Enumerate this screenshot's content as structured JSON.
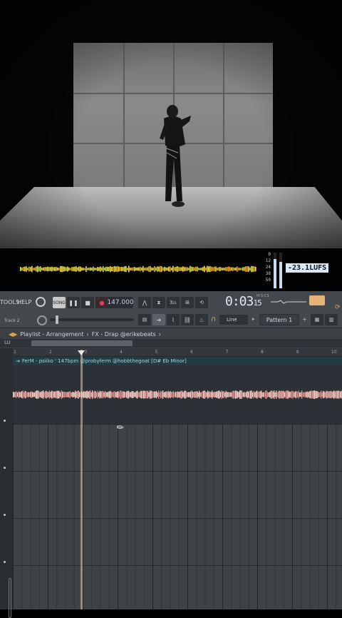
{
  "meter": {
    "db_scale": [
      "0",
      "12",
      "24",
      "38",
      "50"
    ],
    "lufs": "-23.1LUFS",
    "level_left": 0.82,
    "level_right": 0.74
  },
  "daw": {
    "menu": {
      "tools": "TOOLS",
      "help": "HELP"
    },
    "transport": {
      "song_label": "SONG",
      "tempo": "147.000"
    },
    "time": {
      "main": "0:03",
      "sub": "15",
      "units": "M:S:CS"
    },
    "snap": "Line",
    "pattern": "Pattern 1",
    "track_label": "Track 2",
    "breadcrumb": {
      "section": "Playlist - Arrangement",
      "sep": "›",
      "item": "FX - Drap @erikebeats",
      "end": "›"
    },
    "ruler": {
      "first": "1",
      "ticks": [
        "2",
        "3",
        "4",
        "5",
        "6",
        "7",
        "8",
        "9",
        "10"
      ]
    },
    "clip_title": "FerM - psiiko ' 147bpm @probyferm @hobbthegoat [D# Eb Minor]",
    "mini_label": "LU"
  },
  "colors": {
    "clip_header": "#243b42",
    "waveform": "#f2c9c0",
    "playhead": "#eece96",
    "lufs_badge": "#d8e6f6"
  }
}
